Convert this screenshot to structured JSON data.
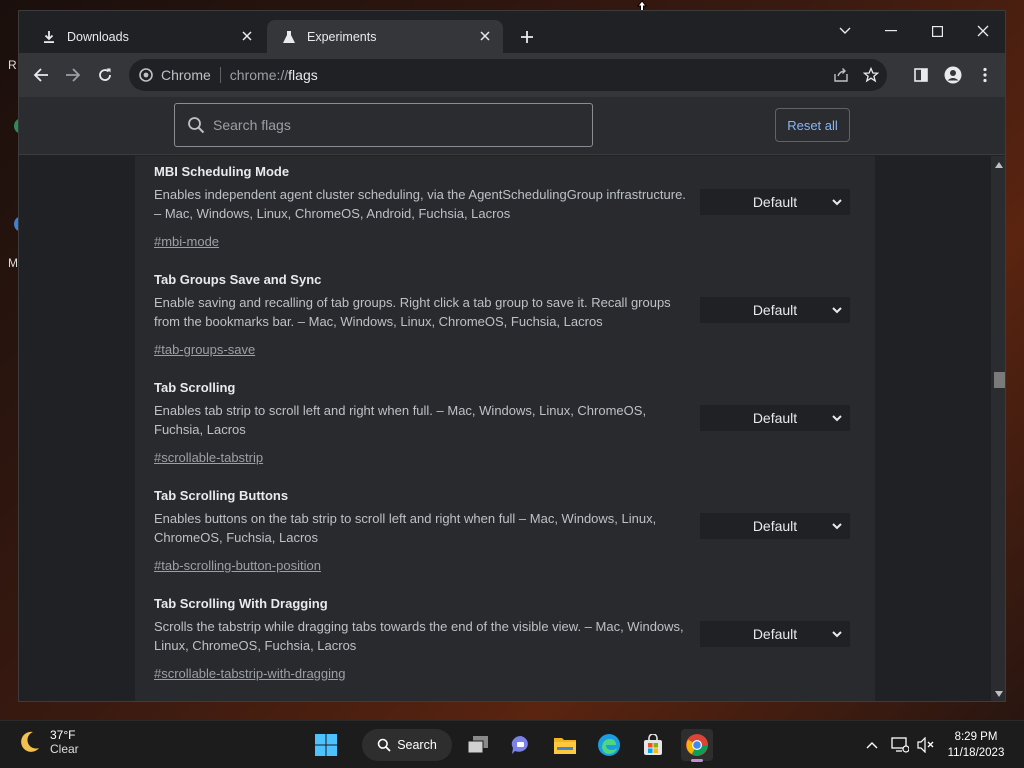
{
  "desktop": {
    "frag_r": "R",
    "frag_m": "M"
  },
  "tabs": [
    {
      "label": "Downloads",
      "icon": "download-icon",
      "active": false
    },
    {
      "label": "Experiments",
      "icon": "flask-icon",
      "active": true
    }
  ],
  "omnibox": {
    "site_chip": "Chrome",
    "url_scheme": "chrome://",
    "url_path": "flags"
  },
  "search": {
    "placeholder": "Search flags",
    "value": ""
  },
  "reset_label": "Reset all",
  "flags": [
    {
      "name": "MBI Scheduling Mode",
      "description": "Enables independent agent cluster scheduling, via the AgentSchedulingGroup infrastructure. – Mac, Windows, Linux, ChromeOS, Android, Fuchsia, Lacros",
      "link": "#mbi-mode",
      "value": "Default"
    },
    {
      "name": "Tab Groups Save and Sync",
      "description": "Enable saving and recalling of tab groups. Right click a tab group to save it. Recall groups from the bookmarks bar. – Mac, Windows, Linux, ChromeOS, Fuchsia, Lacros",
      "link": "#tab-groups-save",
      "value": "Default"
    },
    {
      "name": "Tab Scrolling",
      "description": "Enables tab strip to scroll left and right when full. – Mac, Windows, Linux, ChromeOS, Fuchsia, Lacros",
      "link": "#scrollable-tabstrip",
      "value": "Default"
    },
    {
      "name": "Tab Scrolling Buttons",
      "description": "Enables buttons on the tab strip to scroll left and right when full – Mac, Windows, Linux, ChromeOS, Fuchsia, Lacros",
      "link": "#tab-scrolling-button-position",
      "value": "Default"
    },
    {
      "name": "Tab Scrolling With Dragging",
      "description": "Scrolls the tabstrip while dragging tabs towards the end of the visible view. – Mac, Windows, Linux, ChromeOS, Fuchsia, Lacros",
      "link": "#scrollable-tabstrip-with-dragging",
      "value": "Default"
    }
  ],
  "taskbar": {
    "weather_temp": "37°F",
    "weather_cond": "Clear",
    "search_label": "Search",
    "time": "8:29 PM",
    "date": "11/18/2023"
  },
  "colors": {
    "link_blue": "#8ab4f8",
    "background": "#202124",
    "panel": "#292a2d"
  }
}
